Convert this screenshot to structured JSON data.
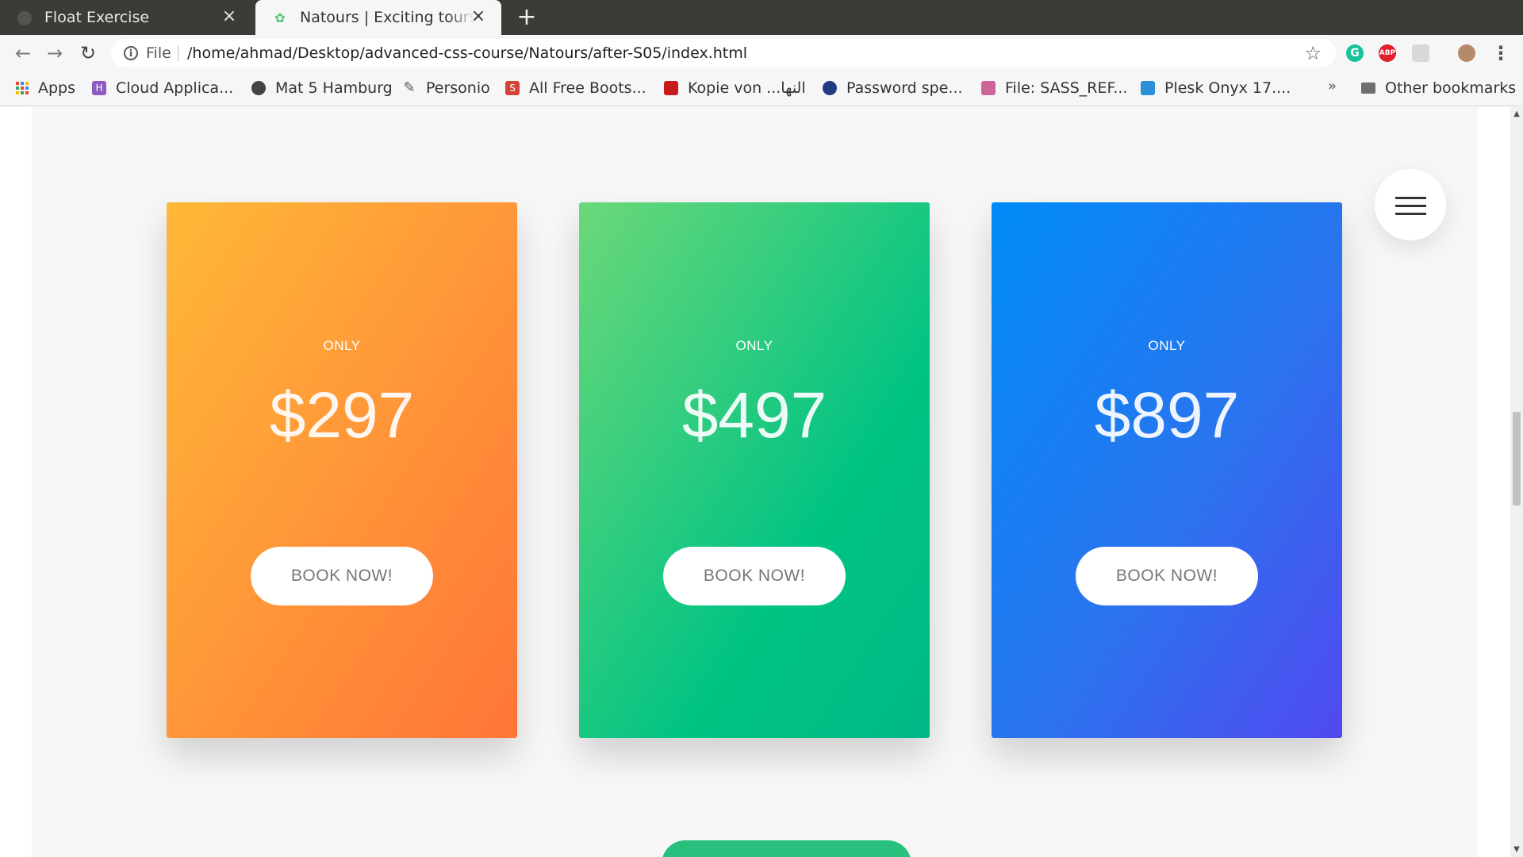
{
  "browser": {
    "tabs": [
      {
        "title": "Float Exercise",
        "active": false
      },
      {
        "title": "Natours | Exciting tours for adventurous people",
        "active": true
      }
    ],
    "url_scheme": "File",
    "url": "/home/ahmad/Desktop/advanced-css-course/Natours/after-S05/index.html",
    "bookmarks": [
      {
        "label": "Apps",
        "icon": "apps-icon"
      },
      {
        "label": "Cloud Applica...",
        "icon": "cloud-app-icon",
        "color": "#8e5bc1"
      },
      {
        "label": "Mat 5 Hamburg",
        "icon": "globe-icon",
        "color": "#444444"
      },
      {
        "label": "Personio",
        "icon": "personio-icon",
        "color": "#555555"
      },
      {
        "label": "All Free Boots...",
        "icon": "s-icon",
        "color": "#d2453a"
      },
      {
        "label": "Kopie von ...النها",
        "icon": "pdf-icon",
        "color": "#c71a1a"
      },
      {
        "label": "Password spe...",
        "icon": "password-icon",
        "color": "#1f3b84"
      },
      {
        "label": "File: SASS_REF...",
        "icon": "sass-icon",
        "color": "#cf649a"
      },
      {
        "label": "Plesk Onyx 17....",
        "icon": "plesk-icon",
        "color": "#2d8fd8"
      }
    ],
    "bookmarks_more": "»",
    "other_bookmarks": "Other bookmarks"
  },
  "pricing": {
    "cards": [
      {
        "only": "ONLY",
        "price": "$297",
        "button": "BOOK NOW!"
      },
      {
        "only": "ONLY",
        "price": "$497",
        "button": "BOOK NOW!"
      },
      {
        "only": "ONLY",
        "price": "$897",
        "button": "BOOK NOW!"
      }
    ]
  },
  "colors": {
    "orange_start": "#ffb838",
    "orange_end": "#ff7538",
    "green_start": "#6cd87a",
    "green_end": "#00b886",
    "blue_start": "#008bf7",
    "blue_end": "#5149f0"
  }
}
